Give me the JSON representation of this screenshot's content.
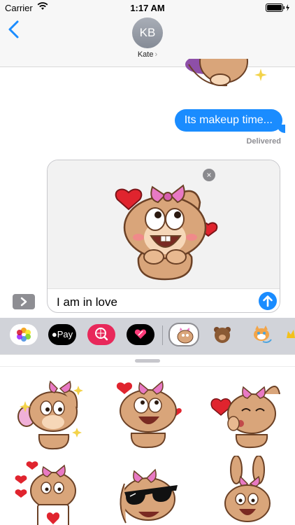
{
  "status_bar": {
    "carrier": "Carrier",
    "time": "1:17 AM"
  },
  "header": {
    "avatar_initials": "KB",
    "contact_name": "Kate",
    "contact_chevron": "›"
  },
  "thread": {
    "outgoing_message": "Its makeup time...",
    "status": "Delivered"
  },
  "composer": {
    "text": "I am in love",
    "remove_symbol": "×"
  },
  "app_strip": {
    "apple_pay_label": "Pay"
  },
  "colors": {
    "accent": "#1a8cff",
    "bunny_fur": "#d9a57a",
    "bow_pink": "#e879c4"
  }
}
